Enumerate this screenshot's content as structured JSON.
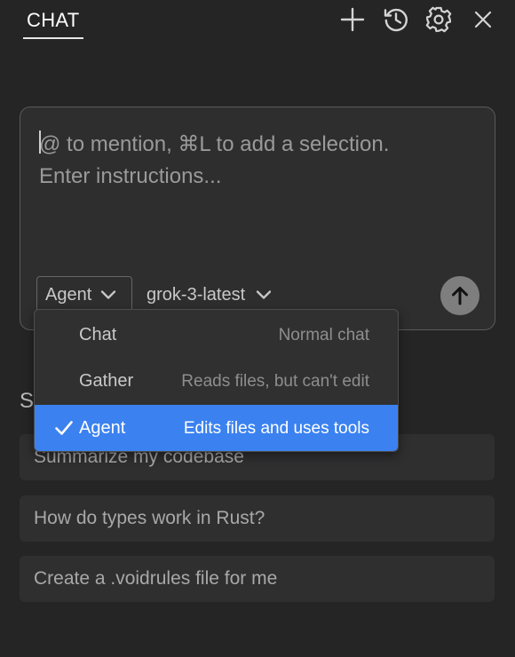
{
  "header": {
    "tab_label": "CHAT",
    "icons": [
      "plus-icon",
      "history-icon",
      "gear-icon",
      "close-icon"
    ]
  },
  "composer": {
    "placeholder": "@ to mention, ⌘L to add a selection.\nEnter instructions...",
    "mode_label": "Agent",
    "model_label": "grok-3-latest",
    "send_icon": "arrow-up-icon"
  },
  "mode_menu": {
    "options": [
      {
        "name": "Chat",
        "description": "Normal chat",
        "selected": false
      },
      {
        "name": "Gather",
        "description": "Reads files, but can't edit",
        "selected": false
      },
      {
        "name": "Agent",
        "description": "Edits files and uses tools",
        "selected": true
      }
    ],
    "selected_color": "#3b82f0"
  },
  "suggestions": {
    "heading_visible": "S",
    "items": [
      "Summarize my codebase",
      "How do types work in Rust?",
      "Create a .voidrules file for me"
    ]
  },
  "colors": {
    "background": "#252526",
    "accent": "#3b82f0"
  }
}
